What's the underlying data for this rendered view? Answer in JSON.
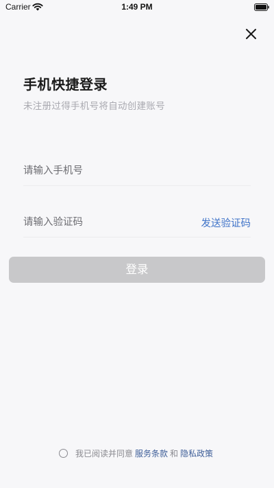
{
  "status_bar": {
    "carrier": "Carrier",
    "time": "1:49 PM",
    "icons": [
      "wifi-icon",
      "battery-icon"
    ]
  },
  "header": {
    "close_icon": "close-icon"
  },
  "login": {
    "title": "手机快捷登录",
    "subtitle": "未注册过得手机号将自动创建账号",
    "phone_placeholder": "请输入手机号",
    "phone_value": "",
    "code_placeholder": "请输入验证码",
    "code_value": "",
    "send_code_label": "发送验证码",
    "login_button_label": "登录"
  },
  "agreement": {
    "checked": false,
    "prefix": "我已阅读并同意",
    "terms_label": "服务条款",
    "and_text": "和",
    "privacy_label": "隐私政策"
  },
  "colors": {
    "background": "#f7f7f9",
    "accent": "#3f73c8",
    "button_disabled": "#c8c8ca",
    "subtitle": "#a9a9b0"
  }
}
